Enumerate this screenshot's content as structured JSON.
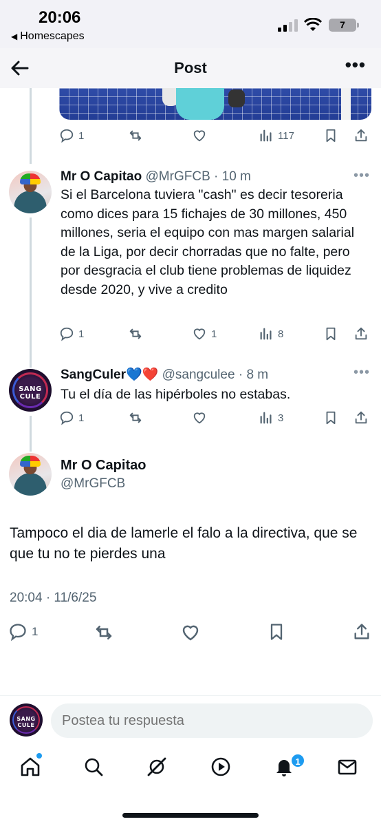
{
  "status_bar": {
    "time": "20:06",
    "back_app": "Homescapes",
    "battery": "7"
  },
  "header": {
    "title": "Post"
  },
  "top_post_actions": {
    "replies": "1",
    "views": "117"
  },
  "replies": [
    {
      "name": "Mr O Capitao",
      "handle": "@MrGFCB",
      "age": "10 m",
      "text": "Si el Barcelona tuviera \"cash\" es decir tesoreria como dices para 15 fichajes de 30 millones, 450 millones, seria el equipo con mas margen salarial de la Liga, por decir chorradas que no falte, pero por desgracia el club tiene problemas de liquidez desde 2020, y vive a credito",
      "replies": "1",
      "likes": "1",
      "views": "8"
    },
    {
      "name": "SangCuler💙❤️",
      "handle": "@sangculee",
      "age": "8 m",
      "text": "Tu el día  de las hipérboles no estabas.",
      "replies": "1",
      "likes": "",
      "views": "3",
      "avatar_text": "SANG CULE"
    }
  ],
  "main_post": {
    "name": "Mr O Capitao",
    "handle": "@MrGFCB",
    "text": "Tampoco el dia de lamerle el falo a la directiva, que se que tu no te pierdes una",
    "timestamp": "20:04 · 11/6/25",
    "replies": "1"
  },
  "reply_bar": {
    "placeholder": "Postea tu respuesta",
    "avatar_text": "SANG CULE"
  },
  "tab_bar": {
    "items": [
      "home-icon",
      "search-icon",
      "grok-icon",
      "video-icon",
      "bell-icon",
      "mail-icon"
    ],
    "notification_count": "1"
  },
  "colors": {
    "accent": "#1d9bf0",
    "text": "#0f1419",
    "muted": "#536471"
  }
}
